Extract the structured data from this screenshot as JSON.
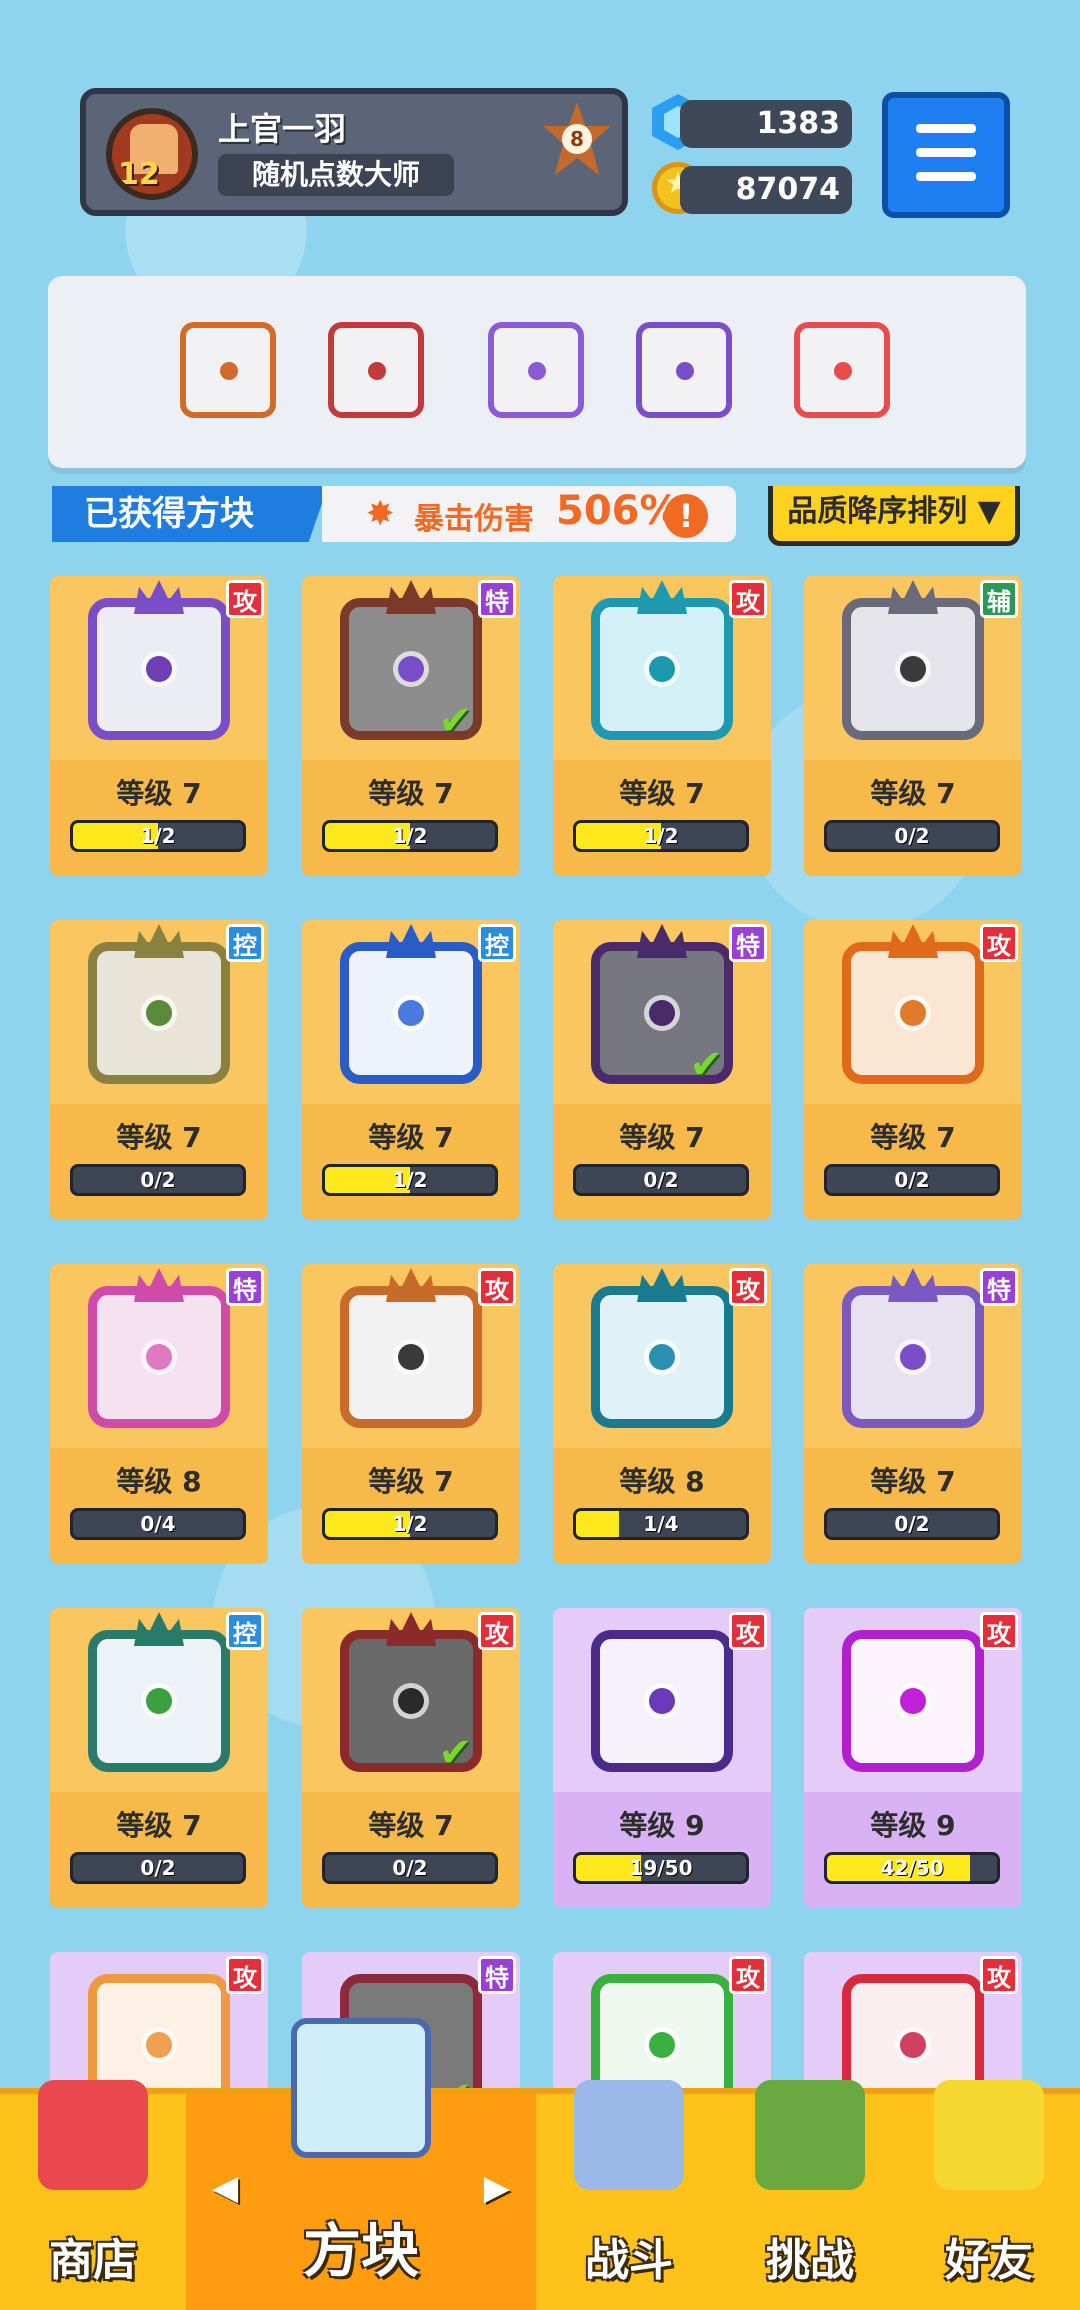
{
  "player": {
    "name": "上官一羽",
    "level": "12",
    "title": "随机点数大师",
    "rank": "8"
  },
  "currency": {
    "gems": "1383",
    "coins": "87074"
  },
  "header": {
    "obtained_label": "已获得方块",
    "crit_label": "暴击伤害",
    "crit_value": "506%",
    "crit_info": "!",
    "sort_label": "品质降序排列 ▼"
  },
  "equipped": [
    {
      "icon": "infinity-block-icon",
      "color": "#d06b2a"
    },
    {
      "icon": "saw-block-icon",
      "color": "#c23a3a"
    },
    {
      "icon": "crack-block-icon",
      "color": "#8a5bd6"
    },
    {
      "icon": "prism-block-icon",
      "color": "#7a4ec9"
    },
    {
      "icon": "rainbow-block-icon",
      "color": "#e84c4c"
    }
  ],
  "cards": [
    {
      "name": "vortex-block",
      "tag": "攻",
      "tag_color": "#e52e3a",
      "level": "等级 7",
      "progress": "1/2",
      "fraction": 0.5,
      "frame": "#7a4ec9",
      "art_bg": "#ececf4",
      "dot": "#6f3fb6",
      "owned": false,
      "rarity": "legend"
    },
    {
      "name": "infinity-block",
      "tag": "特",
      "tag_color": "#9a3fd8",
      "level": "等级 7",
      "progress": "1/2",
      "fraction": 0.5,
      "frame": "#7a3a2a",
      "art_bg": "#8d8d8d",
      "dot": "#7a4ec9",
      "owned": true,
      "rarity": "legend"
    },
    {
      "name": "ice-spear-block",
      "tag": "攻",
      "tag_color": "#e52e3a",
      "level": "等级 7",
      "progress": "1/2",
      "fraction": 0.5,
      "frame": "#1e9ab0",
      "art_bg": "#d2f0f5",
      "dot": "#1c98ac",
      "owned": false,
      "rarity": "legend"
    },
    {
      "name": "fang-block",
      "tag": "辅",
      "tag_color": "#2a9a58",
      "level": "等级 7",
      "progress": "0/2",
      "fraction": 0,
      "frame": "#6a6a7a",
      "art_bg": "#e4e4ea",
      "dot": "#3a3a3a",
      "owned": false,
      "rarity": "legend"
    },
    {
      "name": "shield-block",
      "tag": "控",
      "tag_color": "#2a8ee0",
      "level": "等级 7",
      "progress": "0/2",
      "fraction": 0,
      "frame": "#8a8040",
      "art_bg": "#e8e4d8",
      "dot": "#5a8a3a",
      "owned": false,
      "rarity": "legend"
    },
    {
      "name": "snowflake-block",
      "tag": "控",
      "tag_color": "#2a8ee0",
      "level": "等级 7",
      "progress": "1/2",
      "fraction": 0.5,
      "frame": "#2a5cc8",
      "art_bg": "#eef3fb",
      "dot": "#4a7ae0",
      "owned": false,
      "rarity": "legend"
    },
    {
      "name": "shadow-block",
      "tag": "特",
      "tag_color": "#9a3fd8",
      "level": "等级 7",
      "progress": "0/2",
      "fraction": 0,
      "frame": "#4a2a6a",
      "art_bg": "#777780",
      "dot": "#4a2a6a",
      "owned": true,
      "rarity": "legend"
    },
    {
      "name": "flame-block",
      "tag": "攻",
      "tag_color": "#e52e3a",
      "level": "等级 7",
      "progress": "0/2",
      "fraction": 0,
      "frame": "#e06a1a",
      "art_bg": "#fbe6d4",
      "dot": "#e07a2a",
      "owned": false,
      "rarity": "legend"
    },
    {
      "name": "blade-block",
      "tag": "特",
      "tag_color": "#9a3fd8",
      "level": "等级 8",
      "progress": "0/4",
      "fraction": 0,
      "frame": "#d04aa8",
      "art_bg": "#f6e2ef",
      "dot": "#e07ac0",
      "owned": false,
      "rarity": "legend"
    },
    {
      "name": "pistol-block",
      "tag": "攻",
      "tag_color": "#e52e3a",
      "level": "等级 7",
      "progress": "1/2",
      "fraction": 0.5,
      "frame": "#c86a2a",
      "art_bg": "#f2f2f2",
      "dot": "#3a3a3a",
      "owned": false,
      "rarity": "legend"
    },
    {
      "name": "whirlpool-block",
      "tag": "攻",
      "tag_color": "#e52e3a",
      "level": "等级 8",
      "progress": "1/4",
      "fraction": 0.25,
      "frame": "#1a7a90",
      "art_bg": "#e0f2f8",
      "dot": "#2a90b0",
      "owned": false,
      "rarity": "legend"
    },
    {
      "name": "haze-block",
      "tag": "特",
      "tag_color": "#9a3fd8",
      "level": "等级 7",
      "progress": "0/2",
      "fraction": 0,
      "frame": "#7a5ac0",
      "art_bg": "#e6e2f0",
      "dot": "#7a4ec9",
      "owned": false,
      "rarity": "legend"
    },
    {
      "name": "wind-block",
      "tag": "控",
      "tag_color": "#2a8ee0",
      "level": "等级 7",
      "progress": "0/2",
      "fraction": 0,
      "frame": "#2a7a6a",
      "art_bg": "#edf2f6",
      "dot": "#3aa040",
      "owned": false,
      "rarity": "legend"
    },
    {
      "name": "blackhole-block",
      "tag": "攻",
      "tag_color": "#e52e3a",
      "level": "等级 7",
      "progress": "0/2",
      "fraction": 0,
      "frame": "#8a2a2a",
      "art_bg": "#6a6a6a",
      "dot": "#2a2a2a",
      "owned": true,
      "rarity": "legend"
    },
    {
      "name": "scythe-block",
      "tag": "攻",
      "tag_color": "#e52e3a",
      "level": "等级 9",
      "progress": "19/50",
      "fraction": 0.38,
      "frame": "#4a2a8a",
      "art_bg": "#f4f2f8",
      "dot": "#6a3ab8",
      "owned": false,
      "rarity": "epic"
    },
    {
      "name": "pixel-block",
      "tag": "攻",
      "tag_color": "#e52e3a",
      "level": "等级 9",
      "progress": "42/50",
      "fraction": 0.84,
      "frame": "#b020d0",
      "art_bg": "#fbf4fd",
      "dot": "#c020d8",
      "owned": false,
      "rarity": "epic"
    },
    {
      "name": "target-block",
      "tag": "攻",
      "tag_color": "#e52e3a",
      "level": "",
      "progress": "",
      "fraction": 0,
      "frame": "#f09a40",
      "art_bg": "#fdf0e4",
      "dot": "#f0a050",
      "owned": false,
      "rarity": "epic"
    },
    {
      "name": "mystery-block",
      "tag": "特",
      "tag_color": "#9a3fd8",
      "level": "",
      "progress": "",
      "fraction": 0,
      "frame": "#8a2a3a",
      "art_bg": "#7a7a7a",
      "dot": "#c04a6a",
      "owned": true,
      "rarity": "epic"
    },
    {
      "name": "toxic-block",
      "tag": "攻",
      "tag_color": "#e52e3a",
      "level": "",
      "progress": "",
      "fraction": 0,
      "frame": "#3ab040",
      "art_bg": "#eef8ee",
      "dot": "#3ab040",
      "owned": false,
      "rarity": "epic"
    },
    {
      "name": "lightning-block",
      "tag": "攻",
      "tag_color": "#e52e3a",
      "level": "",
      "progress": "",
      "fraction": 0,
      "frame": "#d82a3a",
      "art_bg": "#fbeef0",
      "dot": "#d04060",
      "owned": false,
      "rarity": "epic"
    }
  ],
  "nav": {
    "shop": "商店",
    "blocks": "方块",
    "battle": "战斗",
    "challenge": "挑战",
    "friends": "好友",
    "prev": "◀",
    "next": "▶"
  }
}
